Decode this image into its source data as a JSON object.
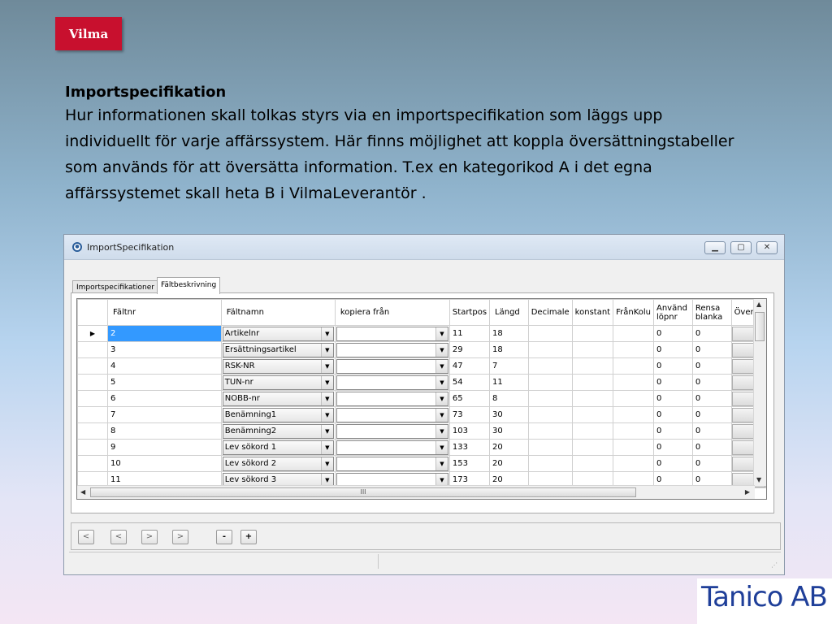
{
  "logo": {
    "text": "Vilma"
  },
  "intro": {
    "heading": "Importspecifikation",
    "lines": [
      "Hur informationen skall tolkas styrs via en importspecifikation som läggs upp",
      "individuellt för varje affärssystem. Här finns möjlighet att koppla översättningstabeller",
      "som används för att översätta information. T.ex en kategorikod A i det egna",
      "affärssystemet skall heta B i VilmaLeverantör ."
    ]
  },
  "window": {
    "title": "ImportSpecifikation",
    "icon": "app-icon",
    "tabs": [
      "Importspecifikationer",
      "Fältbeskrivning"
    ],
    "active_tab": "Fältbeskrivning"
  },
  "grid": {
    "columns": [
      "Fältnr",
      "Fältnamn",
      "kopiera från",
      "Startpos",
      "Längd",
      "Decimale",
      "konstant",
      "FrånKolu",
      "Använd löpnr",
      "Rensa blanka",
      "Översä"
    ],
    "rows": [
      {
        "faltnr": "2",
        "faltnamn": "Artikelnr",
        "kopiera": "",
        "startpos": "11",
        "langd": "18",
        "lopnr": "0",
        "rensa": "0"
      },
      {
        "faltnr": "3",
        "faltnamn": "Ersättningsartikel",
        "kopiera": "",
        "startpos": "29",
        "langd": "18",
        "lopnr": "0",
        "rensa": "0"
      },
      {
        "faltnr": "4",
        "faltnamn": "RSK-NR",
        "kopiera": "",
        "startpos": "47",
        "langd": "7",
        "lopnr": "0",
        "rensa": "0"
      },
      {
        "faltnr": "5",
        "faltnamn": "TUN-nr",
        "kopiera": "",
        "startpos": "54",
        "langd": "11",
        "lopnr": "0",
        "rensa": "0"
      },
      {
        "faltnr": "6",
        "faltnamn": "NOBB-nr",
        "kopiera": "",
        "startpos": "65",
        "langd": "8",
        "lopnr": "0",
        "rensa": "0"
      },
      {
        "faltnr": "7",
        "faltnamn": "Benämning1",
        "kopiera": "",
        "startpos": "73",
        "langd": "30",
        "lopnr": "0",
        "rensa": "0"
      },
      {
        "faltnr": "8",
        "faltnamn": "Benämning2",
        "kopiera": "",
        "startpos": "103",
        "langd": "30",
        "lopnr": "0",
        "rensa": "0"
      },
      {
        "faltnr": "9",
        "faltnamn": "Lev sökord 1",
        "kopiera": "",
        "startpos": "133",
        "langd": "20",
        "lopnr": "0",
        "rensa": "0"
      },
      {
        "faltnr": "10",
        "faltnamn": "Lev sökord 2",
        "kopiera": "",
        "startpos": "153",
        "langd": "20",
        "lopnr": "0",
        "rensa": "0"
      },
      {
        "faltnr": "11",
        "faltnamn": "Lev sökord 3",
        "kopiera": "",
        "startpos": "173",
        "langd": "20",
        "lopnr": "0",
        "rensa": "0"
      }
    ],
    "current_row_marker": "▶",
    "hscroll_grip": "III"
  },
  "navbar": {
    "buttons": [
      "<",
      "<",
      ">",
      ">",
      "-",
      "+"
    ]
  },
  "brand": {
    "text": "Tanico AB"
  },
  "colors": {
    "logo_bg": "#c8102e",
    "selection": "#3399ff",
    "brand_text": "#1f3f99"
  }
}
